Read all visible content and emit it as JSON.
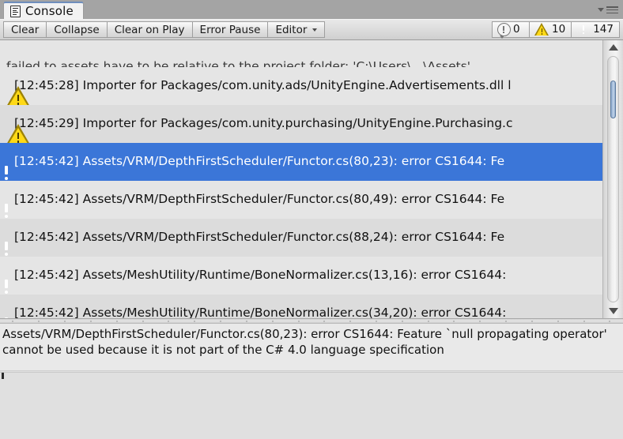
{
  "window": {
    "tab_label": "Console",
    "tab_icon": "console-list-icon",
    "panel_menu_icon": "panel-options-menu-icon"
  },
  "toolbar": {
    "buttons": [
      {
        "label": "Clear",
        "name": "clear-button"
      },
      {
        "label": "Collapse",
        "name": "collapse-button"
      },
      {
        "label": "Clear on Play",
        "name": "clear-on-play-button"
      },
      {
        "label": "Error Pause",
        "name": "error-pause-button"
      }
    ],
    "dropdown": {
      "label": "Editor",
      "name": "editor-dropdown"
    },
    "counters": [
      {
        "kind": "info",
        "icon": "info-bubble-icon",
        "count": "0"
      },
      {
        "kind": "warning",
        "icon": "warning-triangle-icon",
        "count": "10"
      },
      {
        "kind": "error",
        "icon": "error-octagon-icon",
        "count": "147"
      }
    ]
  },
  "log": {
    "partial_top_row": {
      "text": "failed to assets have to be relative to the project folder: 'C:\\Users\\...\\Assets'",
      "icon": "none"
    },
    "entries": [
      {
        "icon": "warning-triangle-icon",
        "severity": "warning",
        "selected": false,
        "text": "[12:45:28] Importer for Packages/com.unity.ads/UnityEngine.Advertisements.dll l"
      },
      {
        "icon": "warning-triangle-icon",
        "severity": "warning",
        "selected": false,
        "text": "[12:45:29] Importer for Packages/com.unity.purchasing/UnityEngine.Purchasing.c"
      },
      {
        "icon": "error-octagon-icon",
        "severity": "error",
        "selected": true,
        "text": "[12:45:42] Assets/VRM/DepthFirstScheduler/Functor.cs(80,23): error CS1644: Fe"
      },
      {
        "icon": "error-octagon-icon",
        "severity": "error",
        "selected": false,
        "text": "[12:45:42] Assets/VRM/DepthFirstScheduler/Functor.cs(80,49): error CS1644: Fe"
      },
      {
        "icon": "error-octagon-icon",
        "severity": "error",
        "selected": false,
        "text": "[12:45:42] Assets/VRM/DepthFirstScheduler/Functor.cs(88,24): error CS1644: Fe"
      },
      {
        "icon": "error-octagon-icon",
        "severity": "error",
        "selected": false,
        "text": "[12:45:42] Assets/MeshUtility/Runtime/BoneNormalizer.cs(13,16): error CS1644:"
      },
      {
        "icon": "error-octagon-icon",
        "severity": "error",
        "selected": false,
        "text": "[12:45:42] Assets/MeshUtility/Runtime/BoneNormalizer.cs(34,20): error CS1644:"
      }
    ]
  },
  "scrollbar": {
    "up_arrow_icon": "scroll-up-arrow-icon",
    "down_arrow_icon": "scroll-down-arrow-icon",
    "thumb_name": "scroll-thumb"
  },
  "detail": {
    "text": "Assets/VRM/DepthFirstScheduler/Functor.cs(80,23): error CS1644: Feature `null propagating operator' cannot be used because it is not part of the C# 4.0 language specification"
  },
  "colors": {
    "selection_blue": "#3b76d8",
    "error_red": "#e11d10",
    "warning_yellow": "#ffd916",
    "tab_accent": "#6f8ebd",
    "panel_bg": "#e0e0e0"
  }
}
